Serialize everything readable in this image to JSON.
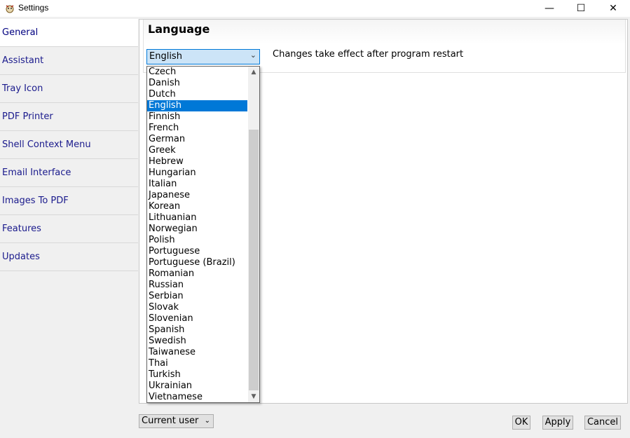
{
  "window": {
    "title": "Settings",
    "icon": "app-icon",
    "minimize_glyph": "—",
    "maximize_glyph": "☐",
    "close_glyph": "✕"
  },
  "sidebar": {
    "items": [
      {
        "label": "General",
        "active": true
      },
      {
        "label": "Assistant"
      },
      {
        "label": "Tray Icon"
      },
      {
        "label": "PDF Printer"
      },
      {
        "label": "Shell Context Menu"
      },
      {
        "label": "Email Interface"
      },
      {
        "label": "Images To PDF"
      },
      {
        "label": "Features"
      },
      {
        "label": "Updates"
      }
    ]
  },
  "language": {
    "title": "Language",
    "selected": "English",
    "arrow": "⌄",
    "hint": "Changes take effect after program restart",
    "options": [
      "Czech",
      "Danish",
      "Dutch",
      "English",
      "Finnish",
      "French",
      "German",
      "Greek",
      "Hebrew",
      "Hungarian",
      "Italian",
      "Japanese",
      "Korean",
      "Lithuanian",
      "Norwegian",
      "Polish",
      "Portuguese",
      "Portuguese (Brazil)",
      "Romanian",
      "Russian",
      "Serbian",
      "Slovak",
      "Slovenian",
      "Spanish",
      "Swedish",
      "Taiwanese",
      "Thai",
      "Turkish",
      "Ukrainian",
      "Vietnamese"
    ],
    "selected_index": 3
  },
  "footer": {
    "scope": "Current user",
    "scope_arrow": "⌄",
    "ok": "OK",
    "apply": "Apply",
    "cancel": "Cancel"
  },
  "colors": {
    "selection": "#0078d7",
    "combo_background": "#cce4f7",
    "sidebar_text": "#1a1a8c"
  }
}
